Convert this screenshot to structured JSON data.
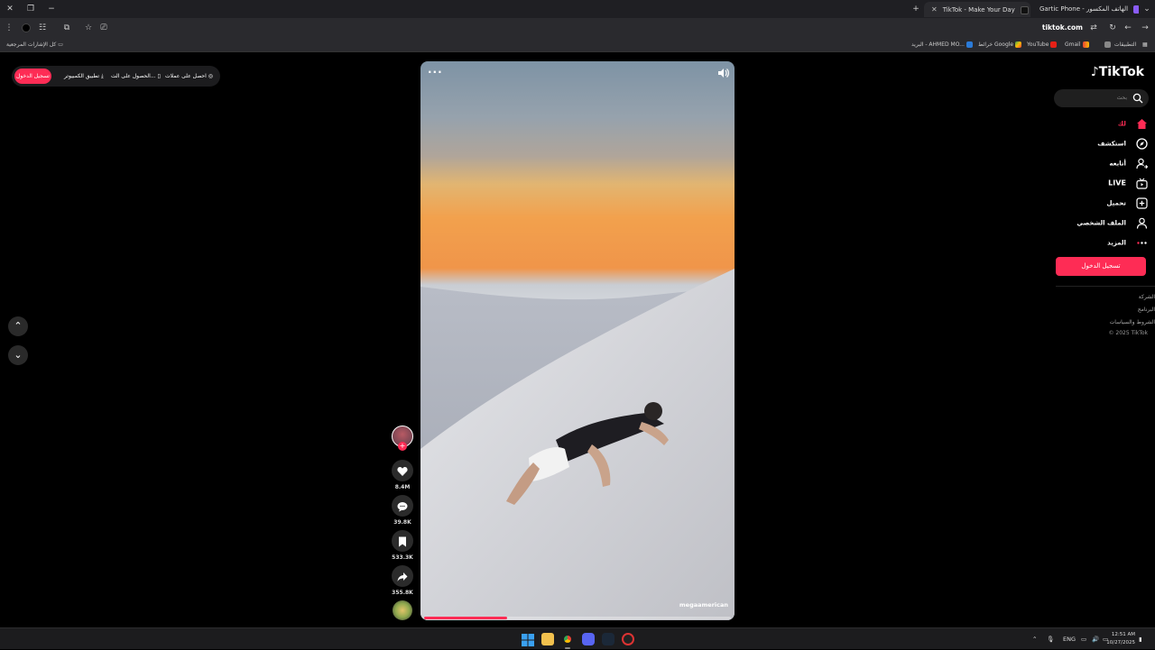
{
  "browser": {
    "tabs": [
      {
        "title": "TikTok - Make Your Day",
        "active": true
      },
      {
        "title": "Gartic Phone - الهاتف المكسور",
        "active": false
      }
    ],
    "url": "tiktok.com",
    "bookmarks": [
      "التطبيقات",
      "Gmail",
      "YouTube",
      "خرائط Google",
      "البريد - AHMED MO..."
    ],
    "all_bookmarks": "كل الإشارات المرجعية"
  },
  "topbar": {
    "login": "تسجيل الدخول",
    "desktop_app": "تطبيق الكمبيوتر",
    "get_app": "الحصول على الت...",
    "coins": "احصل على عملات"
  },
  "video": {
    "watermark": "megaamerican",
    "progress_percent": 27
  },
  "actions": {
    "likes": "8.4M",
    "comments": "39.8K",
    "saves": "533.3K",
    "shares": "355.8K"
  },
  "sidebar": {
    "logo": "TikTok",
    "search_placeholder": "بحث",
    "items": [
      {
        "label": "لك",
        "icon": "home-icon",
        "active": true
      },
      {
        "label": "استكشف",
        "icon": "compass-icon"
      },
      {
        "label": "أتابعه",
        "icon": "following-icon"
      },
      {
        "label": "LIVE",
        "icon": "live-icon"
      },
      {
        "label": "تحميل",
        "icon": "upload-icon"
      },
      {
        "label": "الملف الشخصي",
        "icon": "profile-icon"
      },
      {
        "label": "المزيد",
        "icon": "more-icon"
      }
    ],
    "login_button": "تسجيل الدخول",
    "footer": [
      "الشركة",
      "البرنامج",
      "الشروط والسياسات",
      "© 2025 TikTok"
    ]
  },
  "taskbar": {
    "lang": "ENG",
    "time": "12:51 AM",
    "date": "10/27/2025"
  },
  "colors": {
    "accent": "#fe2c55",
    "background": "#000000"
  }
}
